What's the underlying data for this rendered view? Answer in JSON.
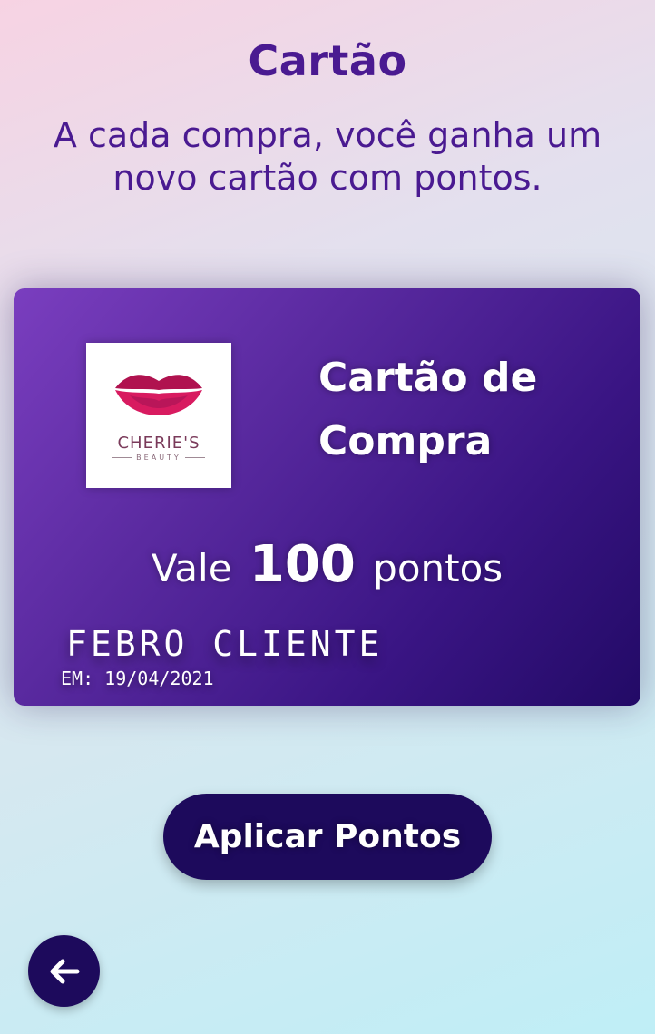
{
  "page": {
    "title": "Cartão",
    "subtitle": "A cada compra, você ganha um novo cartão com pontos."
  },
  "card": {
    "logo": {
      "name": "CHERIE'S",
      "sub": "BEAUTY"
    },
    "title": "Cartão de Compra",
    "value_prefix": "Vale",
    "value_points": "100",
    "value_suffix": "pontos",
    "holder": "FEBRO CLIENTE",
    "date": "EM: 19/04/2021"
  },
  "actions": {
    "apply_label": "Aplicar Pontos",
    "back_icon": "arrow-left-icon"
  },
  "colors": {
    "primary": "#4a1a91",
    "button": "#1d0a5c",
    "card_start": "#7a3ebf",
    "card_end": "#220a66",
    "lips": "#c2185b"
  }
}
